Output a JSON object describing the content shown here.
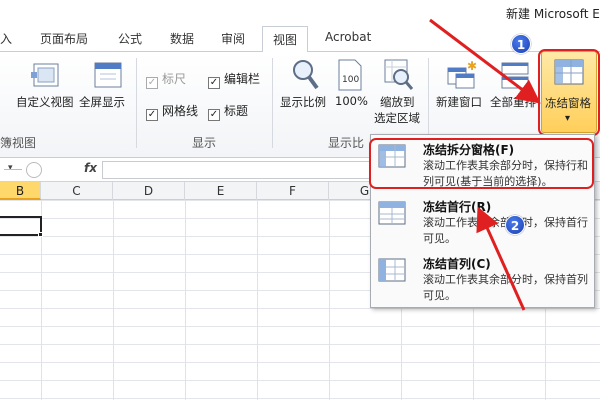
{
  "window": {
    "title": "新建 Microsoft E"
  },
  "tabs": [
    {
      "label": "入",
      "active": false
    },
    {
      "label": "页面布局",
      "active": false
    },
    {
      "label": "公式",
      "active": false
    },
    {
      "label": "数据",
      "active": false
    },
    {
      "label": "审阅",
      "active": false
    },
    {
      "label": "视图",
      "active": true
    },
    {
      "label": "Acrobat",
      "active": false
    }
  ],
  "ribbon": {
    "workbook_views": {
      "group_label": "簿视图",
      "custom_view": "自定义视图",
      "full_screen": "全屏显示"
    },
    "show": {
      "group_label": "显示",
      "ruler": {
        "label": "标尺",
        "checked": true,
        "disabled": true
      },
      "formula_bar": {
        "label": "编辑栏",
        "checked": true
      },
      "gridlines": {
        "label": "网格线",
        "checked": true
      },
      "headings": {
        "label": "标题",
        "checked": true
      }
    },
    "zoom": {
      "group_label": "显示比",
      "zoom": "显示比例",
      "zoom_100": "100%",
      "zoom_selection_line1": "缩放到",
      "zoom_selection_line2": "选定区域"
    },
    "window": {
      "new_window": "新建窗口",
      "arrange_all": "全部重排",
      "freeze_panes": "冻结窗格",
      "dropdown_glyph": "▾"
    }
  },
  "formula_bar": {
    "fx": "fx",
    "name_arrow": "▾"
  },
  "columns": [
    "B",
    "C",
    "D",
    "E",
    "F",
    "G"
  ],
  "freeze_menu": {
    "items": [
      {
        "title": "冻结拆分窗格(F)",
        "desc": "滚动工作表其余部分时，保持行和列可见(基于当前的选择)。",
        "icon": "freeze-panes-icon"
      },
      {
        "title": "冻结首行(R)",
        "desc": "滚动工作表其余部分时，保持首行可见。",
        "icon": "freeze-top-row-icon"
      },
      {
        "title": "冻结首列(C)",
        "desc": "滚动工作表其余部分时，保持首列可见。",
        "icon": "freeze-first-column-icon"
      }
    ]
  },
  "annotations": {
    "badge1": "1",
    "badge2": "2"
  },
  "colors": {
    "highlight_red": "#e02020",
    "badge_blue": "#1d3fb0",
    "selected_column": "#ffd86b"
  }
}
